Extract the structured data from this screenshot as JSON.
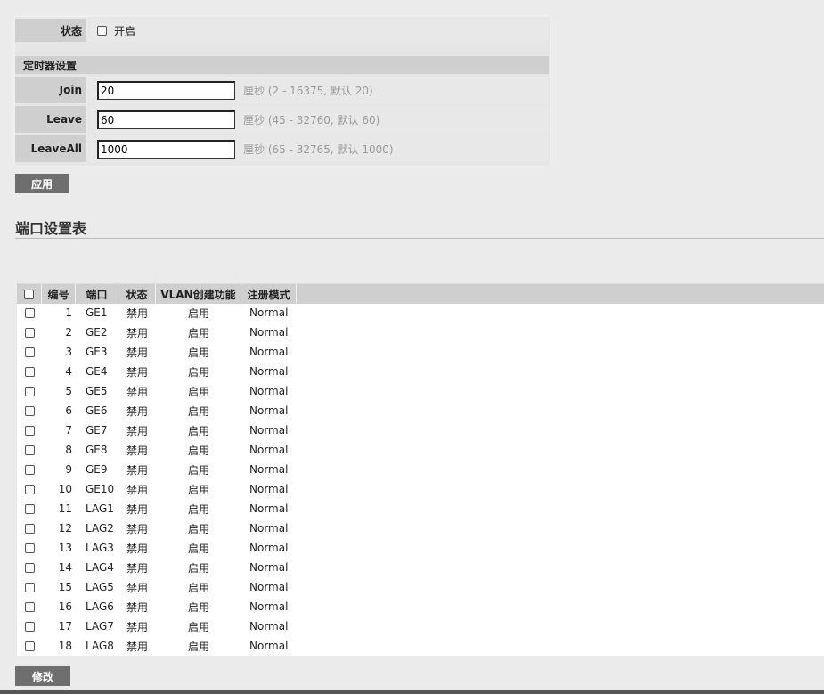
{
  "settings": {
    "status_label": "状态",
    "status_option": "开启",
    "timer_section": "定时器设置",
    "join_label": "Join",
    "join_value": "20",
    "join_hint": "厘秒 (2 - 16375, 默认 20)",
    "leave_label": "Leave",
    "leave_value": "60",
    "leave_hint": "厘秒 (45 - 32760, 默认 60)",
    "leaveall_label": "LeaveAll",
    "leaveall_value": "1000",
    "leaveall_hint": "厘秒 (65 - 32765, 默认 1000)",
    "apply_label": "应用"
  },
  "port_table": {
    "title": "端口设置表",
    "headers": [
      "编号",
      "端口",
      "状态",
      "VLAN创建功能",
      "注册模式"
    ],
    "rows": [
      {
        "id": "1",
        "port": "GE1",
        "status": "禁用",
        "vlan": "启用",
        "mode": "Normal"
      },
      {
        "id": "2",
        "port": "GE2",
        "status": "禁用",
        "vlan": "启用",
        "mode": "Normal"
      },
      {
        "id": "3",
        "port": "GE3",
        "status": "禁用",
        "vlan": "启用",
        "mode": "Normal"
      },
      {
        "id": "4",
        "port": "GE4",
        "status": "禁用",
        "vlan": "启用",
        "mode": "Normal"
      },
      {
        "id": "5",
        "port": "GE5",
        "status": "禁用",
        "vlan": "启用",
        "mode": "Normal"
      },
      {
        "id": "6",
        "port": "GE6",
        "status": "禁用",
        "vlan": "启用",
        "mode": "Normal"
      },
      {
        "id": "7",
        "port": "GE7",
        "status": "禁用",
        "vlan": "启用",
        "mode": "Normal"
      },
      {
        "id": "8",
        "port": "GE8",
        "status": "禁用",
        "vlan": "启用",
        "mode": "Normal"
      },
      {
        "id": "9",
        "port": "GE9",
        "status": "禁用",
        "vlan": "启用",
        "mode": "Normal"
      },
      {
        "id": "10",
        "port": "GE10",
        "status": "禁用",
        "vlan": "启用",
        "mode": "Normal"
      },
      {
        "id": "11",
        "port": "LAG1",
        "status": "禁用",
        "vlan": "启用",
        "mode": "Normal"
      },
      {
        "id": "12",
        "port": "LAG2",
        "status": "禁用",
        "vlan": "启用",
        "mode": "Normal"
      },
      {
        "id": "13",
        "port": "LAG3",
        "status": "禁用",
        "vlan": "启用",
        "mode": "Normal"
      },
      {
        "id": "14",
        "port": "LAG4",
        "status": "禁用",
        "vlan": "启用",
        "mode": "Normal"
      },
      {
        "id": "15",
        "port": "LAG5",
        "status": "禁用",
        "vlan": "启用",
        "mode": "Normal"
      },
      {
        "id": "16",
        "port": "LAG6",
        "status": "禁用",
        "vlan": "启用",
        "mode": "Normal"
      },
      {
        "id": "17",
        "port": "LAG7",
        "status": "禁用",
        "vlan": "启用",
        "mode": "Normal"
      },
      {
        "id": "18",
        "port": "LAG8",
        "status": "禁用",
        "vlan": "启用",
        "mode": "Normal"
      }
    ],
    "modify_label": "修改"
  }
}
